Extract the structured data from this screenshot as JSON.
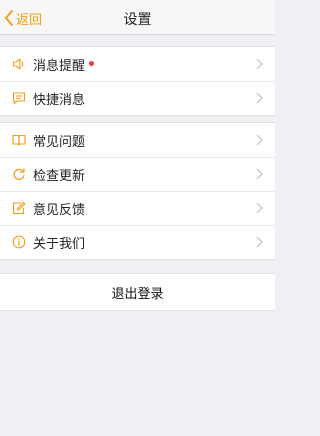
{
  "nav": {
    "back_label": "返回",
    "title": "设置"
  },
  "group1": [
    {
      "label": "消息提醒",
      "icon": "speaker-icon",
      "has_dot": true
    },
    {
      "label": "快捷消息",
      "icon": "chat-icon"
    }
  ],
  "group2": [
    {
      "label": "常见问题",
      "icon": "book-icon"
    },
    {
      "label": "检查更新",
      "icon": "refresh-icon"
    },
    {
      "label": "意见反馈",
      "icon": "edit-icon"
    },
    {
      "label": "关于我们",
      "icon": "info-icon"
    }
  ],
  "logout_label": "退出登录",
  "colors": {
    "accent": "#f39c12",
    "dot": "#e8403b",
    "background": "#efeff4"
  }
}
